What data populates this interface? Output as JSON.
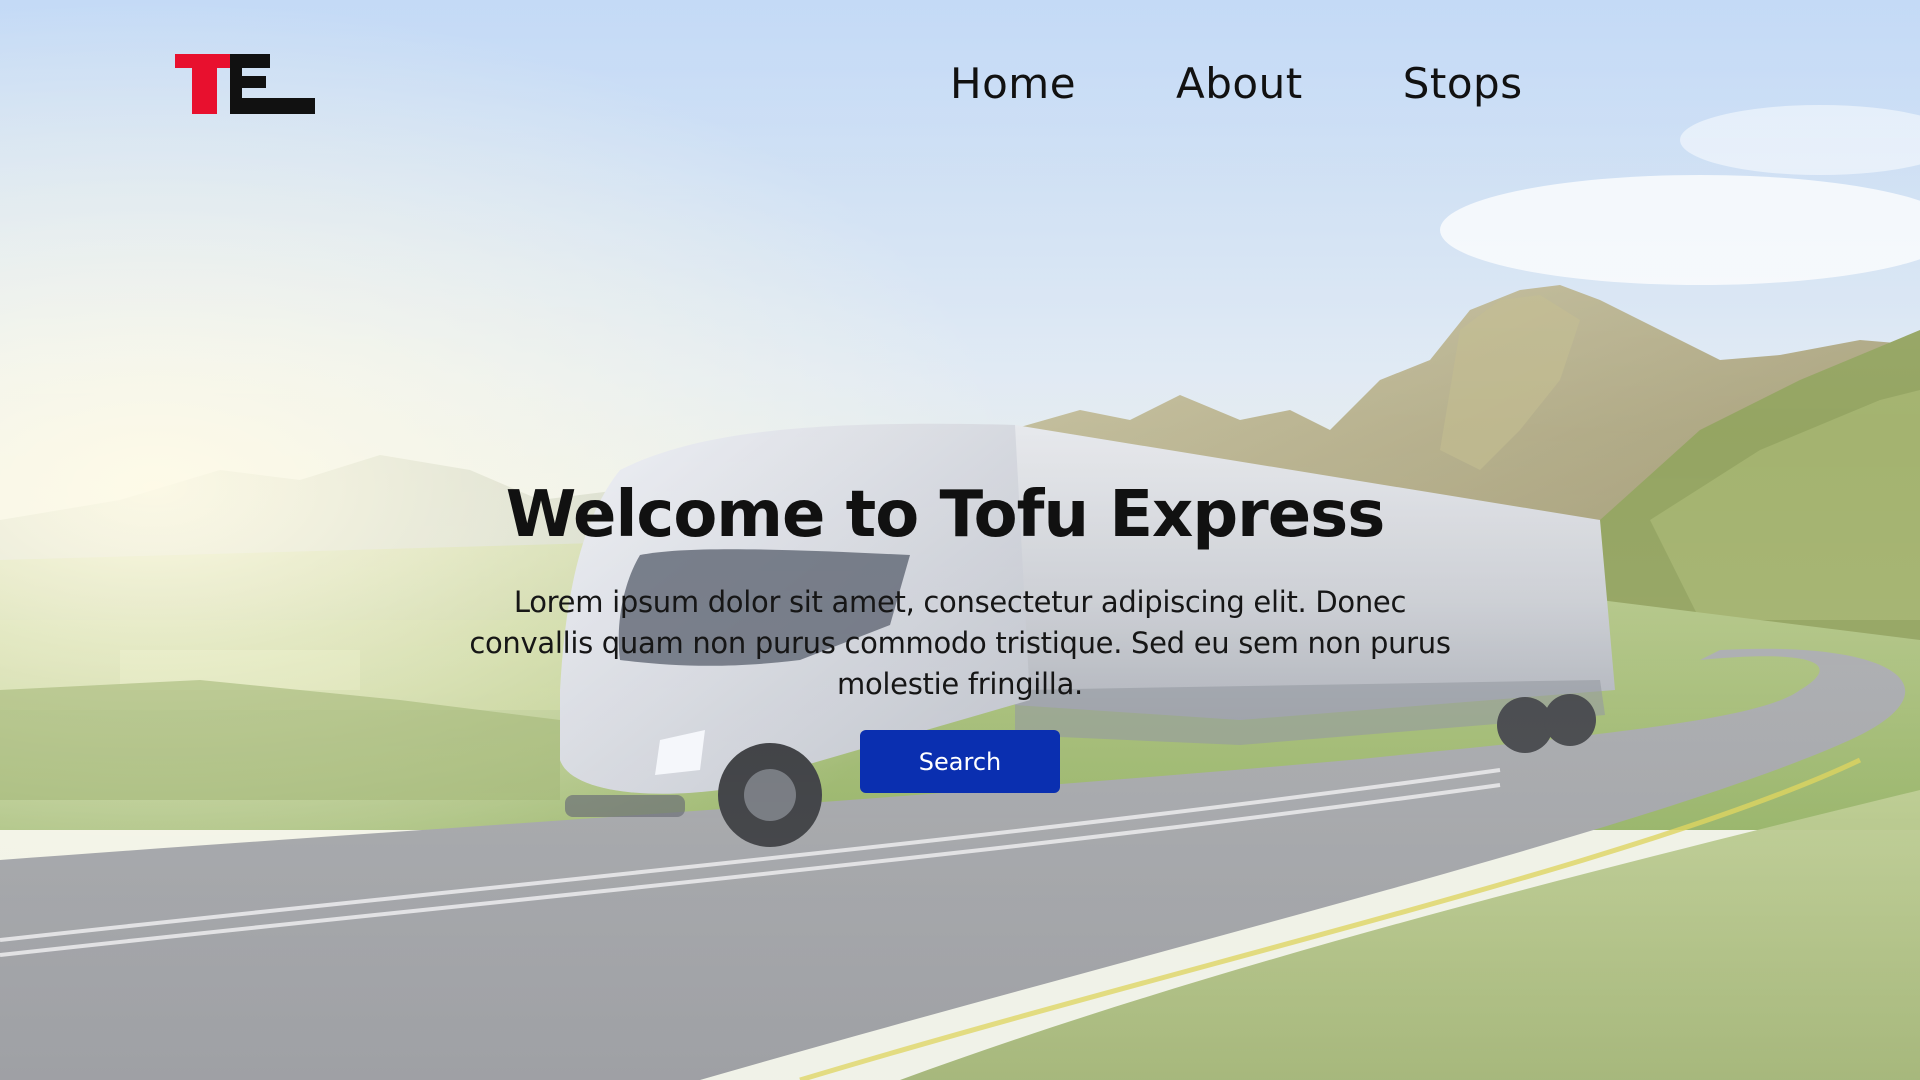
{
  "header": {
    "logo": {
      "text": "TE",
      "colors": {
        "primary": "#e8102e",
        "secondary": "#111111"
      }
    },
    "nav": [
      {
        "label": "Home"
      },
      {
        "label": "About"
      },
      {
        "label": "Stops"
      }
    ]
  },
  "hero": {
    "title": "Welcome to Tofu Express",
    "body": "Lorem ipsum dolor sit amet, consectetur adipiscing elit. Donec convallis quam non purus commodo tristique. Sed eu sem non purus molestie fringilla.",
    "search_label": "Search",
    "background_scene": "truck-on-mountain-road-image"
  },
  "colors": {
    "accent": "#0a2fb0",
    "text": "#111111",
    "logo_red": "#e8102e"
  }
}
